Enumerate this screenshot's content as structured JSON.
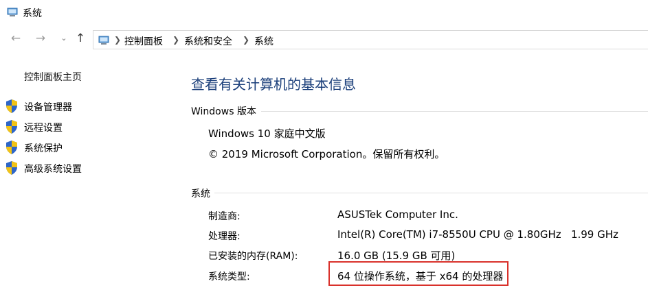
{
  "window": {
    "title": "系统"
  },
  "nav": {
    "back_icon": "arrow-left-icon",
    "forward_icon": "arrow-right-icon",
    "recent_icon": "chevron-down-icon",
    "up_icon": "arrow-up-icon"
  },
  "breadcrumb": [
    "控制面板",
    "系统和安全",
    "系统"
  ],
  "sidebar": {
    "home": "控制面板主页",
    "items": [
      {
        "label": "设备管理器",
        "icon": "uac-shield-icon"
      },
      {
        "label": "远程设置",
        "icon": "uac-shield-icon"
      },
      {
        "label": "系统保护",
        "icon": "uac-shield-icon"
      },
      {
        "label": "高级系统设置",
        "icon": "uac-shield-icon"
      }
    ]
  },
  "main": {
    "title": "查看有关计算机的基本信息",
    "windows_section": {
      "heading": "Windows 版本",
      "edition": "Windows 10 家庭中文版",
      "copyright": "© 2019 Microsoft Corporation。保留所有权利。"
    },
    "system_section": {
      "heading": "系统",
      "rows": [
        {
          "label": "制造商:",
          "value": "ASUSTek Computer Inc."
        },
        {
          "label": "处理器:",
          "value": "Intel(R) Core(TM) i7-8550U CPU @ 1.80GHz   1.99 GHz"
        },
        {
          "label": "已安装的内存(RAM):",
          "value": "16.0 GB (15.9 GB 可用)"
        },
        {
          "label": "系统类型:",
          "value": "64 位操作系统，基于 x64 的处理器"
        }
      ]
    }
  },
  "colors": {
    "title_blue": "#1a3e7a",
    "highlight_red": "#d9312b"
  }
}
